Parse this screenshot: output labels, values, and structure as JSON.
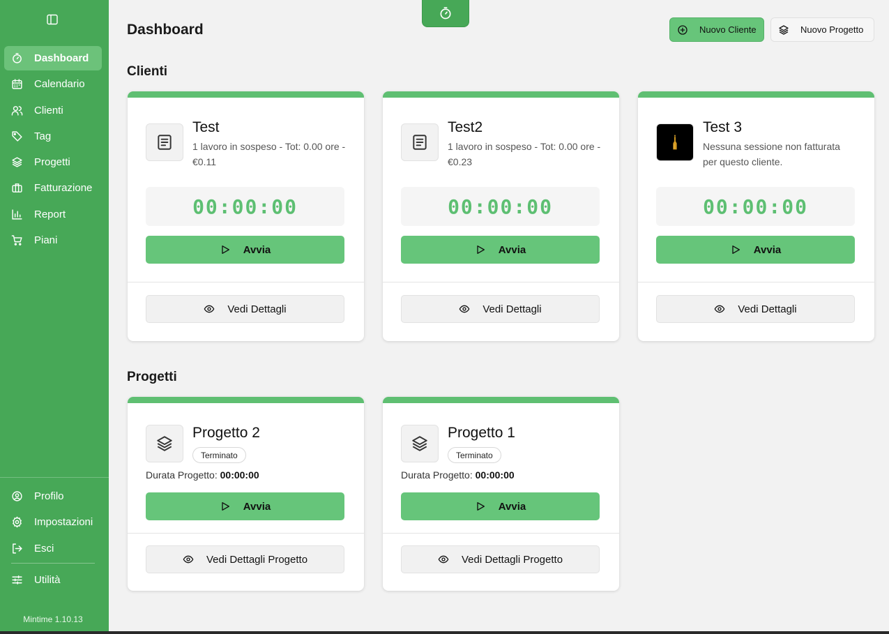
{
  "sidebar": {
    "nav": [
      {
        "label": "Dashboard",
        "icon": "stopwatch-icon",
        "active": true
      },
      {
        "label": "Calendario",
        "icon": "calendar-icon"
      },
      {
        "label": "Clienti",
        "icon": "users-icon"
      },
      {
        "label": "Tag",
        "icon": "tag-icon"
      },
      {
        "label": "Progetti",
        "icon": "layers-icon"
      },
      {
        "label": "Fatturazione",
        "icon": "briefcase-icon"
      },
      {
        "label": "Report",
        "icon": "bar-chart-icon"
      },
      {
        "label": "Piani",
        "icon": "cart-icon"
      }
    ],
    "bottom": [
      {
        "label": "Profilo",
        "icon": "user-circle-icon"
      },
      {
        "label": "Impostazioni",
        "icon": "gear-icon"
      },
      {
        "label": "Esci",
        "icon": "logout-icon"
      },
      {
        "label": "Utilità",
        "icon": "sliders-icon"
      }
    ],
    "version": "Mintime 1.10.13"
  },
  "header": {
    "title": "Dashboard",
    "new_client_label": "Nuovo Cliente",
    "new_project_label": "Nuovo Progetto"
  },
  "sections": {
    "clients_title": "Clienti",
    "projects_title": "Progetti"
  },
  "clients": [
    {
      "name": "Test",
      "subtitle": "1 lavoro in sospeso - Tot: 0.00 ore - €0.11",
      "timer": "00:00:00",
      "start_label": "Avvia",
      "details_label": "Vedi Dettagli",
      "avatar": "document-icon"
    },
    {
      "name": "Test2",
      "subtitle": "1 lavoro in sospeso - Tot: 0.00 ore - €0.23",
      "timer": "00:00:00",
      "start_label": "Avvia",
      "details_label": "Vedi Dettagli",
      "avatar": "document-icon"
    },
    {
      "name": "Test 3",
      "subtitle": "Nessuna sessione non fatturata per questo cliente.",
      "timer": "00:00:00",
      "start_label": "Avvia",
      "details_label": "Vedi Dettagli",
      "avatar": "bottle-logo"
    }
  ],
  "projects": [
    {
      "name": "Progetto 2",
      "status": "Terminato",
      "duration_label": "Durata Progetto:",
      "duration": "00:00:00",
      "start_label": "Avvia",
      "details_label": "Vedi Dettagli Progetto"
    },
    {
      "name": "Progetto 1",
      "status": "Terminato",
      "duration_label": "Durata Progetto:",
      "duration": "00:00:00",
      "start_label": "Avvia",
      "details_label": "Vedi Dettagli Progetto"
    }
  ],
  "colors": {
    "sidebar": "#47a857",
    "accent": "#66c57a",
    "timer_text": "#5dbf72",
    "background": "#f2f2f2"
  }
}
